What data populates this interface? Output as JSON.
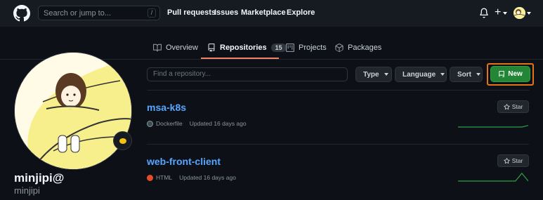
{
  "header": {
    "search_placeholder": "Search or jump to...",
    "search_shortcut": "/",
    "nav": [
      "Pull requests",
      "Issues",
      "Marketplace",
      "Explore"
    ],
    "plus_label": "+"
  },
  "tabs": [
    {
      "label": "Overview"
    },
    {
      "label": "Repositories",
      "count": "15"
    },
    {
      "label": "Projects"
    },
    {
      "label": "Packages"
    }
  ],
  "profile": {
    "display_name": "minjipi@",
    "username": "minjipi"
  },
  "filters": {
    "find_placeholder": "Find a repository...",
    "type_label": "Type",
    "language_label": "Language",
    "sort_label": "Sort",
    "new_label": "New",
    "new_highlight_color": "#e3731a"
  },
  "repos": [
    {
      "name": "msa-k8s",
      "language": "Dockerfile",
      "language_color": "#384d54",
      "updated": "Updated 16 days ago",
      "star_label": "Star",
      "activity": [
        0,
        0,
        0,
        0,
        0,
        0,
        0,
        0,
        0,
        0,
        0,
        0.2
      ]
    },
    {
      "name": "web-front-client",
      "language": "HTML",
      "language_color": "#e34c26",
      "updated": "Updated 16 days ago",
      "star_label": "Star",
      "activity": [
        0,
        0,
        0,
        0,
        0,
        0,
        0,
        0,
        0,
        0,
        1,
        0
      ]
    }
  ],
  "colors": {
    "accent_tab": "#f78166",
    "link": "#58a6ff",
    "new_button": "#238636",
    "sparkline": "#2ea043"
  }
}
